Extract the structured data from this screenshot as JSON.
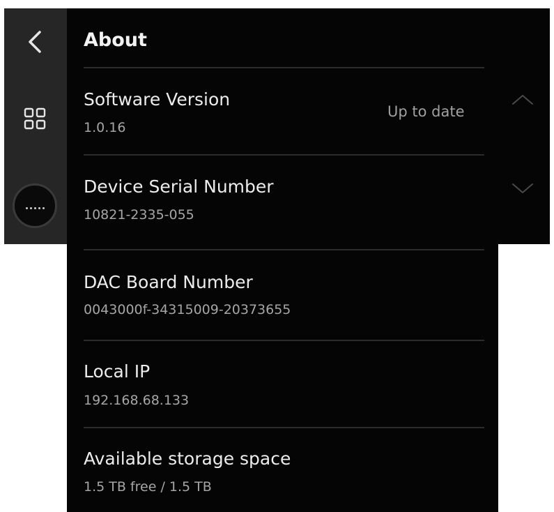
{
  "header": {
    "title": "About"
  },
  "sidebar": {
    "back_icon": "chevron-left-icon",
    "grid_icon": "grid-icon",
    "more_icon": "more-dots-icon"
  },
  "rows": [
    {
      "label": "Software Version",
      "value": "1.0.16",
      "status": "Up to date"
    },
    {
      "label": "Device Serial Number",
      "value": "10821-2335-055"
    },
    {
      "label": "DAC Board Number",
      "value": "0043000f-34315009-20373655"
    },
    {
      "label": "Local IP",
      "value": "192.168.68.133"
    },
    {
      "label": "Available storage space",
      "value": "1.5 TB free / 1.5 TB"
    }
  ],
  "scroll": {
    "up_icon": "chevron-up-icon",
    "down_icon": "chevron-down-icon"
  },
  "colors": {
    "background": "#050505",
    "sidebar": "#262626",
    "text_primary": "#ececec",
    "text_secondary": "#a6a6a6",
    "divider": "#2c2c2c"
  }
}
